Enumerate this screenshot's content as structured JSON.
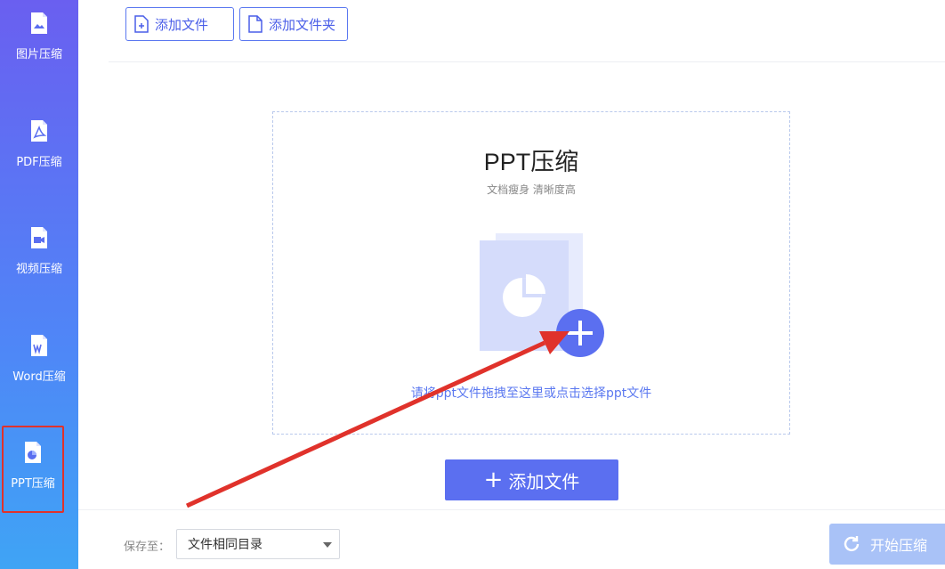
{
  "sidebar": {
    "items": [
      {
        "label": "图片压缩",
        "icon": "image-file-icon"
      },
      {
        "label": "PDF压缩",
        "icon": "pdf-file-icon"
      },
      {
        "label": "视频压缩",
        "icon": "video-file-icon"
      },
      {
        "label": "Word压缩",
        "icon": "word-file-icon"
      },
      {
        "label": "PPT压缩",
        "icon": "ppt-file-icon",
        "active": true
      }
    ]
  },
  "toolbar": {
    "add_file_label": "添加文件",
    "add_folder_label": "添加文件夹"
  },
  "dropzone": {
    "title": "PPT压缩",
    "subtitle": "文档瘦身 清晰度高",
    "hint": "请将ppt文件拖拽至这里或点击选择ppt文件"
  },
  "main": {
    "add_button_label": "添加文件"
  },
  "bottom": {
    "save_label": "保存至：",
    "save_value": "文件相同目录",
    "start_label": "开始压缩"
  },
  "colors": {
    "accent": "#5b6ff0",
    "annotation": "#e0322b"
  }
}
